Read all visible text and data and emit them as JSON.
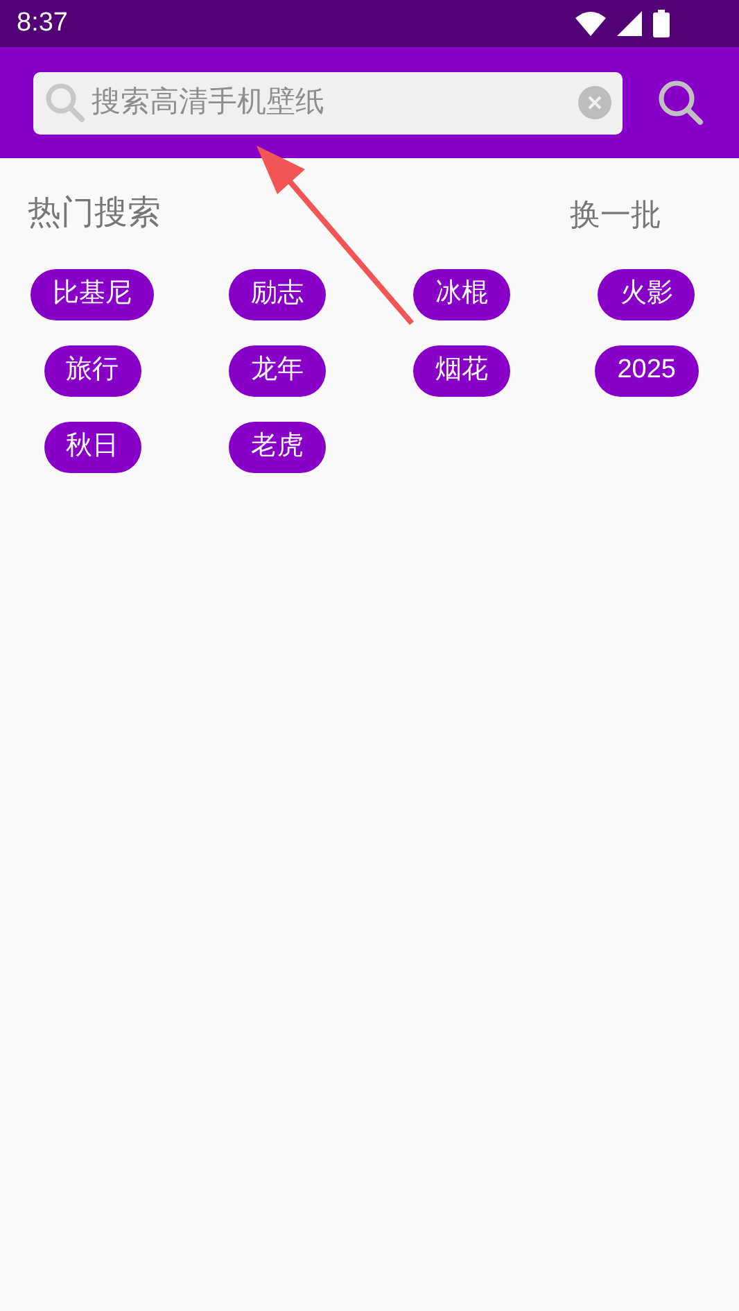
{
  "status_bar": {
    "time": "8:37"
  },
  "search": {
    "placeholder": "搜索高清手机壁纸"
  },
  "hot": {
    "title": "热门搜索",
    "refresh": "换一批",
    "tags": [
      {
        "label": "比基尼"
      },
      {
        "label": "励志"
      },
      {
        "label": "冰棍"
      },
      {
        "label": "火影"
      },
      {
        "label": "旅行"
      },
      {
        "label": "龙年"
      },
      {
        "label": "烟花"
      },
      {
        "label": "2025"
      },
      {
        "label": "秋日"
      },
      {
        "label": "老虎"
      }
    ]
  }
}
